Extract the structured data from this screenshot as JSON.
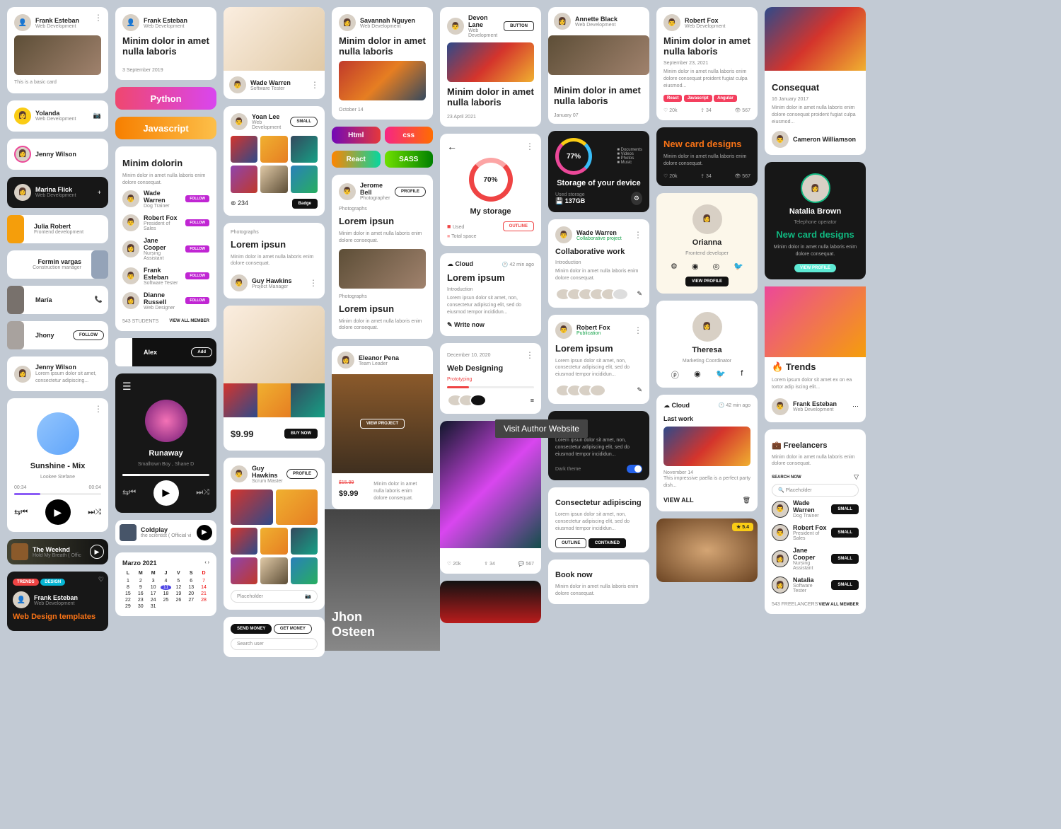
{
  "p": {
    "frank": "Frank Esteban",
    "wd": "Web Development",
    "savannah": "Savannah Nguyen",
    "devon": "Devon Lane",
    "annette": "Annette Black",
    "robert": "Robert Fox",
    "cameron": "Cameron Williamson",
    "natalia": "Natalia Brown",
    "yolanda": "Yolanda",
    "jenny": "Jenny Wilson",
    "marina": "Marina Flick",
    "julia": "Julia Robert",
    "fermin": "Fermin vargas",
    "maria": "María",
    "jhony": "Jhony",
    "alex": "Alex",
    "wade": "Wade Warren",
    "jane": "Jane Cooper",
    "dianne": "Dianne Russell",
    "yoan": "Yoan Lee",
    "guy": "Guy Hawkins",
    "jerome": "Jerome Bell",
    "eleanor": "Eleanor Pena",
    "orianna": "Orianna",
    "theresa": "Theresa",
    "jhon": "Jhon\nOsteen",
    "coldplay": "Coldplay"
  },
  "roles": {
    "st": "Software Tester",
    "phot": "Photographer",
    "pm": "Project Manager",
    "sm": "Scrum Master",
    "tl": "Team Leader",
    "dt": "Dog Trainer",
    "ps": "President of Sales",
    "na": "Nursing Assistant",
    "wdes": "Web Designer",
    "fd": "Frontend development",
    "fdev": "Frontend developer",
    "cm": "Construction manager",
    "tele": "Telephone operator",
    "mc": "Marketing Coordinator",
    "collab": "Collaborative project",
    "pub": "Publication"
  },
  "t": {
    "minim": "Minim dolor in amet nulla laboris",
    "minimd": "Minim dolorin",
    "lorem": "Lorem ipsun",
    "loremt": "Lorem ipsum",
    "conseq": "Consequat",
    "newcard": "New card designs",
    "trends": "Trends",
    "cloud": "Cloud",
    "free": "Freelancers",
    "collab": "Collaborative work",
    "storage": "My storage",
    "storaged": "Storage of your device",
    "webdes": "Web Designing",
    "booknow": "Book now",
    "lastwork": "Last work",
    "consectetur": "Consectetur adipiscing",
    "sunshine": "Sunshine - Mix",
    "runaway": "Runaway",
    "weeknd": "The Weeknd",
    "webdest": "Web Design templates"
  },
  "txt": {
    "basic": "This is a basic card",
    "loremipsum": "Lorem ipsum dolor sit amet, consectetur adipiscing...",
    "loremlong": "Lorem ipsun dolor sit amet, non, consectetur adipiscing elit, sed do eiusmod tempor incididun...",
    "minim2": "Minim dolor in amet nulla laboris enim dolore consequat proident fugiat culpa eiusmod...",
    "minim3": "Minim dolor in amet nulla laboris enim dolore consequat.",
    "intro": "Introduction",
    "photo": "Photographs",
    "proto": "Prototyping",
    "lookee": "Lookee Stefane",
    "smalltown": "Smalltown Boy , Shane D",
    "scientist": "the scientist ( Official vi",
    "holdbreath": "Hold My Breath ( Offic",
    "darktheme": "Dark theme",
    "used": "Used",
    "totalspace": "Total space",
    "usedstorage": "Used storage",
    "paella": "This impressive paella is a perfect party dish...",
    "ante": "Lorem ipsum dolor sit amet ex on ea tortor adip iscing elit..."
  },
  "dates": {
    "sep3": "3 September 2019",
    "oct14": "October 14",
    "apr23": "23 April 2021",
    "jan7": "January 07",
    "sep23": "September 23, 2021",
    "jan16": "16 January 2017",
    "dec10": "December 10, 2020",
    "nov14": "November 14",
    "marzo": "Marzo 2021",
    "42min": "42 min ago"
  },
  "btn": {
    "button": "BUTTON",
    "small": "SMALL",
    "follow": "FOLLOW",
    "add": "Add",
    "profile": "PROFILE",
    "badge": "Badge",
    "buynow": "BUY NOW",
    "outline": "OUTLINE",
    "contained": "CONTAINED",
    "viewproject": "VIEW PROJECT",
    "viewprofile": "VIEW PROFILE",
    "viewall": "VIEW ALL",
    "viewallm": "VIEW ALL MEMBER",
    "viewallf": "VIEW ALL MEMBER",
    "writenow": "Write now",
    "sendmoney": "SEND MONEY",
    "getmoney": "GET MONEY",
    "searchnow": "SEARCH NOW",
    "placeholder": "Placeholder",
    "searchuser": "Search user"
  },
  "tags": {
    "py": "Python",
    "js": "Javascript",
    "html": "Html",
    "css": "css",
    "react": "React",
    "sass": "SASS",
    "reactc": "React",
    "jsc": "Javascript",
    "ang": "Angular",
    "trends": "TRENDS",
    "design": "DESIGN"
  },
  "stats": {
    "like": "20k",
    "share": "34",
    "views": "567",
    "students": "543 STUDENTS",
    "freelancers": "543 FREELANCERS",
    "drib": "234",
    "pct70": "70%",
    "pct77": "77%",
    "gb": "137GB",
    "price": "$9.99",
    "priceold": "$15.99",
    "rating": "5.4",
    "t1": "00:34",
    "t2": "00:04",
    "docs": "Documents",
    "vid": "Videos",
    "photos": "Photos",
    "music": "Music"
  },
  "cal": {
    "days": [
      "L",
      "M",
      "M",
      "J",
      "V",
      "S",
      "D"
    ],
    "dates": [
      [
        "1",
        "2",
        "3",
        "4",
        "5",
        "6",
        "7"
      ],
      [
        "8",
        "9",
        "10",
        "11",
        "12",
        "13",
        "14"
      ],
      [
        "15",
        "16",
        "17",
        "18",
        "19",
        "20",
        "21"
      ],
      [
        "22",
        "23",
        "24",
        "25",
        "26",
        "27",
        "28"
      ],
      [
        "29",
        "30",
        "31",
        "",
        "",
        "",
        ""
      ]
    ]
  },
  "tooltip": "Visit Author Website"
}
